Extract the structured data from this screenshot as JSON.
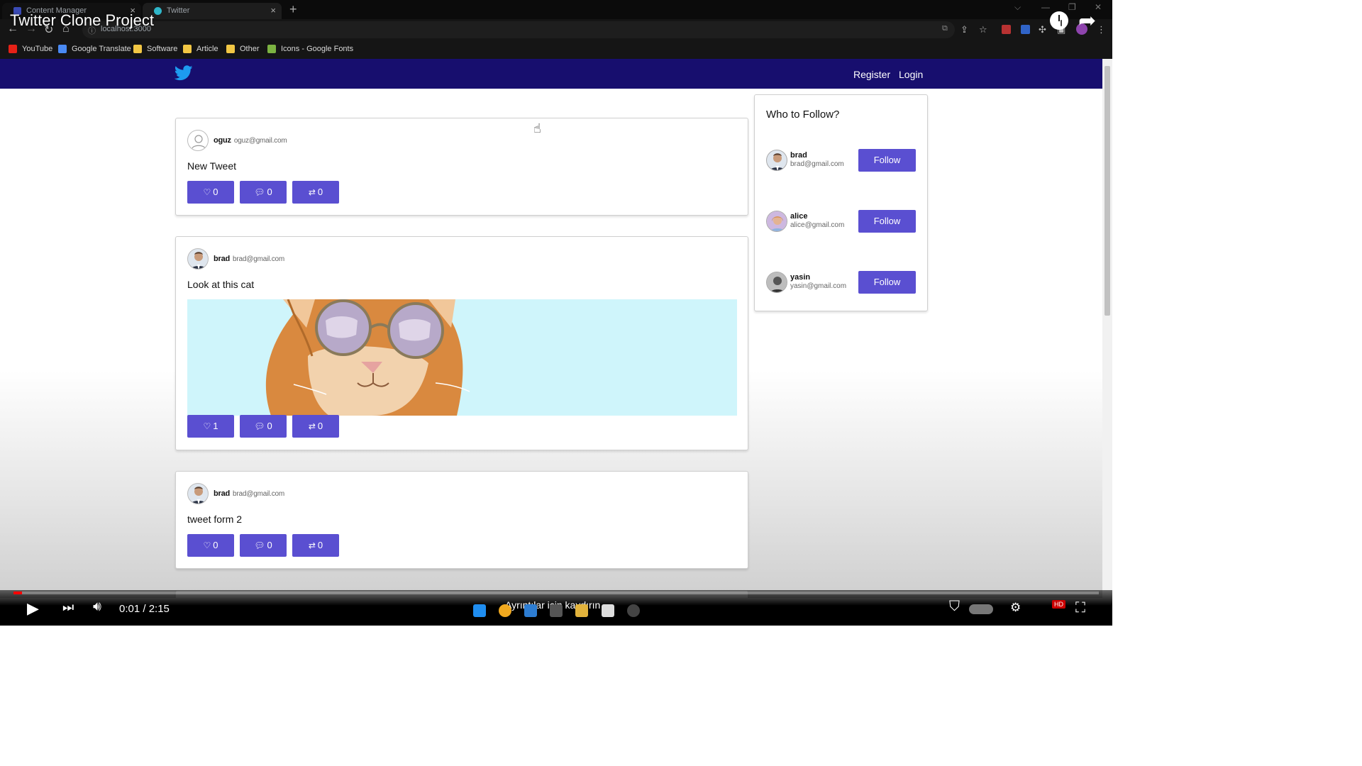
{
  "video_title": "Twitter Clone Project",
  "browser": {
    "tabs": [
      {
        "label": "Content Manager",
        "favicon_color": "#3a4bb5"
      },
      {
        "label": "Twitter",
        "favicon_color": "#2fb6c9"
      }
    ],
    "url": "localhost:3000",
    "bookmarks": [
      {
        "label": "YouTube",
        "icon_color": "#e62117"
      },
      {
        "label": "Google Translate",
        "icon_color": "#4a8af4"
      },
      {
        "label": "Software",
        "icon_color": "#f2c744"
      },
      {
        "label": "Article",
        "icon_color": "#f2c744"
      },
      {
        "label": "Other",
        "icon_color": "#f2c744"
      },
      {
        "label": "Icons - Google Fonts",
        "icon_color": "#7cb342"
      }
    ]
  },
  "navbar": {
    "logo": "twitter-bird-icon",
    "register_label": "Register",
    "login_label": "Login",
    "background": "#170e6e"
  },
  "tweets": [
    {
      "username": "oguz",
      "email": "oguz@gmail.com",
      "text": "New Tweet",
      "likes": "0",
      "comments": "0",
      "retweets": "0",
      "avatar": "default-user-icon"
    },
    {
      "username": "brad",
      "email": "brad@gmail.com",
      "text": "Look at this cat",
      "likes": "1",
      "comments": "0",
      "retweets": "0",
      "avatar": "brad-photo",
      "image": "cat-with-sunglasses"
    },
    {
      "username": "brad",
      "email": "brad@gmail.com",
      "text": "tweet form 2",
      "likes": "0",
      "comments": "0",
      "retweets": "0",
      "avatar": "brad-photo"
    }
  ],
  "who_to_follow": {
    "title": "Who to Follow?",
    "users": [
      {
        "username": "brad",
        "email": "brad@gmail.com",
        "button": "Follow"
      },
      {
        "username": "alice",
        "email": "alice@gmail.com",
        "button": "Follow"
      },
      {
        "username": "yasin",
        "email": "yasin@gmail.com",
        "button": "Follow"
      }
    ]
  },
  "player": {
    "time": "0:01 / 2:15",
    "progress": 0.008,
    "scroll_hint": "Ayrıntılar için kaydırın"
  },
  "colors": {
    "accent": "#5a4fd1",
    "progress": "#ff0000"
  }
}
